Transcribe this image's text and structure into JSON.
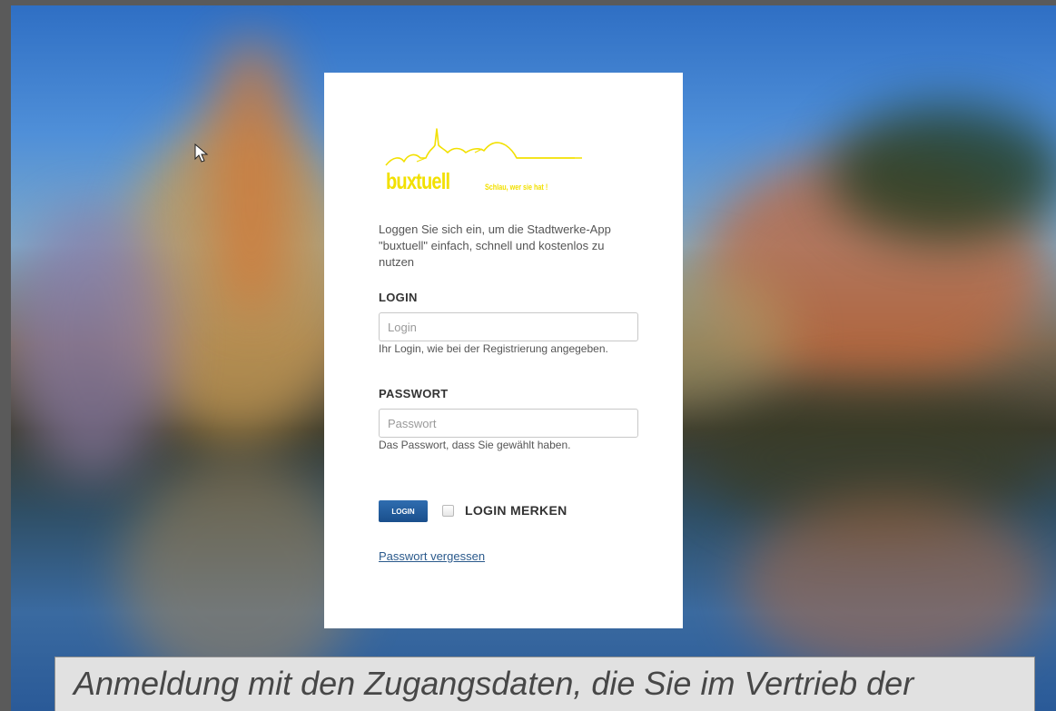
{
  "logo": {
    "brand": "buxtuell",
    "slogan": "Schlau, wer sie hat !",
    "color": "#f2e000"
  },
  "login_form": {
    "intro_text": "Loggen Sie sich ein, um die Stadtwerke-App \"buxtuell\" einfach, schnell und kostenlos zu nutzen",
    "login_label": "LOGIN",
    "login_placeholder": "Login",
    "login_help": "Ihr Login, wie bei der Registrierung angegeben.",
    "password_label": "PASSWORT",
    "password_placeholder": "Passwort",
    "password_help": "Das Passwort, dass Sie gewählt haben.",
    "submit_label": "LOGIN",
    "remember_label": "LOGIN MERKEN",
    "remember_checked": false,
    "forgot_link": "Passwort vergessen",
    "button_color": "#1f5796",
    "link_color": "#2b5a8c"
  },
  "caption": {
    "text": "Anmeldung mit den Zugangsdaten, die Sie im Vertrieb der"
  },
  "icons": {
    "cursor": "mouse-pointer-icon",
    "checkbox": "checkbox-icon"
  }
}
